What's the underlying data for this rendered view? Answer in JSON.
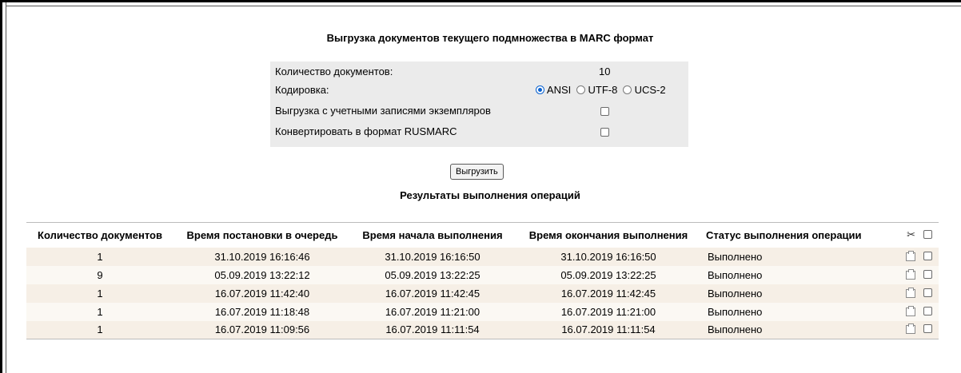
{
  "export": {
    "title": "Выгрузка документов текущего подмножества в MARC формат",
    "doc_count_label": "Количество документов:",
    "doc_count_value": "10",
    "encoding_label": "Кодировка:",
    "encoding_options": [
      "ANSI",
      "UTF-8",
      "UCS-2"
    ],
    "encoding_selected": "ANSI",
    "with_items_label": "Выгрузка с учетными записями экземпляров",
    "with_items_checked": false,
    "rusmarc_label": "Конвертировать в формат RUSMARC",
    "rusmarc_checked": false,
    "button_label": "Выгрузить"
  },
  "results": {
    "title": "Результаты выполнения операций",
    "columns": [
      "Количество документов",
      "Время постановки в очередь",
      "Время начала выполнения",
      "Время окончания выполнения",
      "Статус выполнения операции"
    ],
    "header_icons": [
      "scissors-icon",
      "checkbox"
    ],
    "rows": [
      {
        "count": "1",
        "queued": "31.10.2019 16:16:46",
        "started": "31.10.2019 16:16:50",
        "finished": "31.10.2019 16:16:50",
        "status": "Выполнено"
      },
      {
        "count": "9",
        "queued": "05.09.2019 13:22:12",
        "started": "05.09.2019 13:22:25",
        "finished": "05.09.2019 13:22:25",
        "status": "Выполнено"
      },
      {
        "count": "1",
        "queued": "16.07.2019 11:42:40",
        "started": "16.07.2019 11:42:45",
        "finished": "16.07.2019 11:42:45",
        "status": "Выполнено"
      },
      {
        "count": "1",
        "queued": "16.07.2019 11:18:48",
        "started": "16.07.2019 11:21:00",
        "finished": "16.07.2019 11:21:00",
        "status": "Выполнено"
      },
      {
        "count": "1",
        "queued": "16.07.2019 11:09:56",
        "started": "16.07.2019 11:11:54",
        "finished": "16.07.2019 11:11:54",
        "status": "Выполнено"
      }
    ]
  }
}
